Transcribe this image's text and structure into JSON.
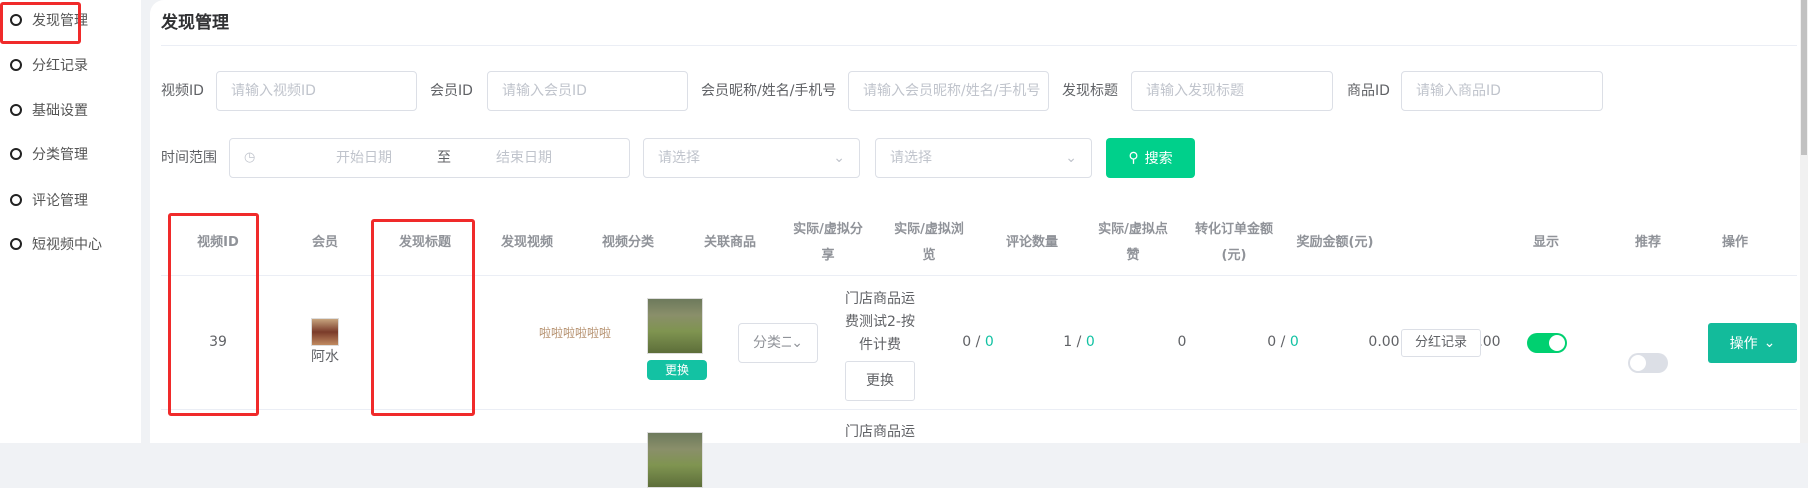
{
  "sidebar": {
    "items": [
      {
        "label": "发现管理",
        "active": true
      },
      {
        "label": "分红记录"
      },
      {
        "label": "基础设置"
      },
      {
        "label": "分类管理"
      },
      {
        "label": "评论管理"
      },
      {
        "label": "短视频中心"
      }
    ]
  },
  "page": {
    "title": "发现管理"
  },
  "filters": {
    "video_id": {
      "label": "视频ID",
      "placeholder": "请输入视频ID"
    },
    "member_id": {
      "label": "会员ID",
      "placeholder": "请输入会员ID"
    },
    "member_name": {
      "label": "会员昵称/姓名/手机号",
      "placeholder": "请输入会员昵称/姓名/手机号"
    },
    "title": {
      "label": "发现标题",
      "placeholder": "请输入发现标题"
    },
    "goods_id": {
      "label": "商品ID",
      "placeholder": "请输入商品ID"
    },
    "time_range": {
      "label": "时间范围",
      "start": "开始日期",
      "sep": "至",
      "end": "结束日期"
    },
    "select1": "请选择",
    "select2": "请选择",
    "search": "搜索"
  },
  "table": {
    "headers": [
      "视频ID",
      "会员",
      "发现标题",
      "发现视频",
      "视频分类",
      "关联商品",
      "实际/虚拟分享",
      "实际/虚拟浏览",
      "评论数量",
      "实际/虚拟点赞",
      "转化订单金额(元)",
      "奖励金额(元)",
      "显示",
      "推荐",
      "操作"
    ],
    "rows": [
      {
        "id": "39",
        "member": "阿水",
        "title": "啦啦啦啦啦啦",
        "video_btn": "更换",
        "category": "分类二",
        "goods": "门店商品运费测试2-按件计费",
        "goods_btn": "更换",
        "share_real": "0",
        "share_virtual": "0",
        "view_real": "1",
        "view_virtual": "0",
        "comments": "0",
        "like_real": "0",
        "like_virtual": "0",
        "order_amount": "0.00",
        "reward": "0.00",
        "dividend_btn": "分红记录",
        "show": true,
        "recommend": false,
        "action": "操作"
      },
      {
        "goods": "门店商品运"
      }
    ]
  },
  "colors": {
    "accent": "#13c2a3",
    "search": "#00d08b",
    "highlight": "#f02a2a"
  }
}
